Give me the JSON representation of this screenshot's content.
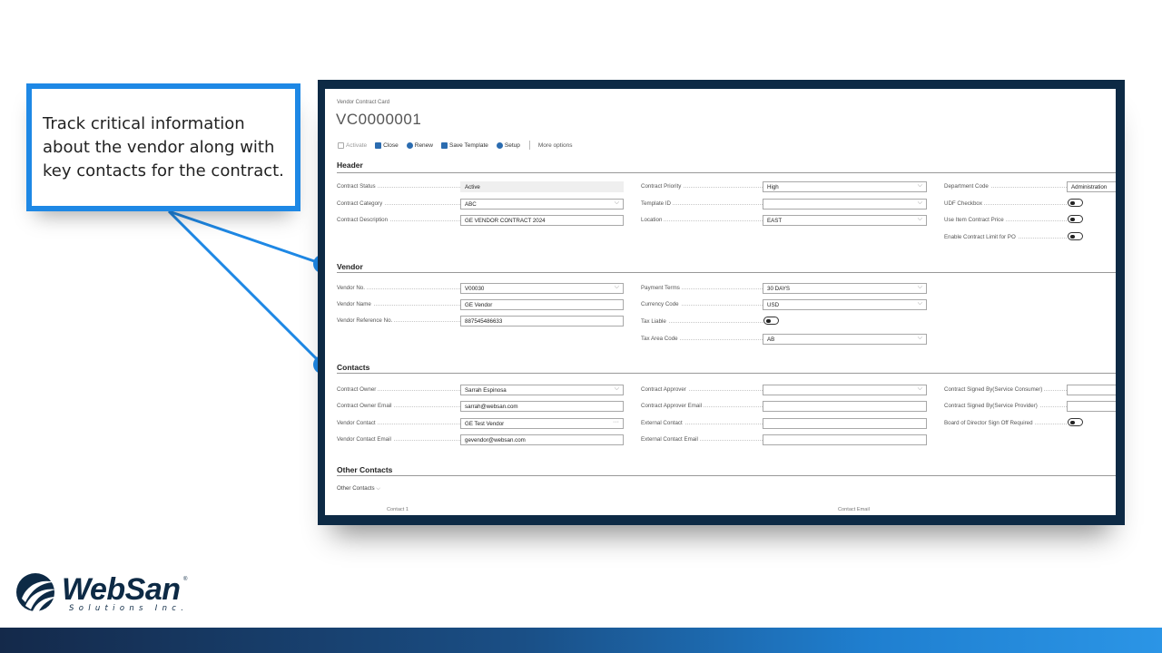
{
  "callout": {
    "text": "Track critical information about the vendor along with key contacts for the contract."
  },
  "page": {
    "breadcrumb": "Vendor Contract Card",
    "title": "VC0000001"
  },
  "toolbar": {
    "activate": "Activate",
    "close": "Close",
    "renew": "Renew",
    "save_template": "Save Template",
    "setup": "Setup",
    "more_options": "More options"
  },
  "sections": {
    "header": "Header",
    "vendor": "Vendor",
    "contacts": "Contacts",
    "other_contacts": "Other Contacts"
  },
  "header": {
    "contract_status": {
      "label": "Contract Status",
      "value": "Active"
    },
    "contract_category": {
      "label": "Contract Category",
      "value": "ABC"
    },
    "contract_description": {
      "label": "Contract Description",
      "value": "GE VENDOR CONTRACT 2024"
    },
    "contract_priority": {
      "label": "Contract Priority",
      "value": "High"
    },
    "template_id": {
      "label": "Template ID",
      "value": ""
    },
    "location": {
      "label": "Location",
      "value": "EAST"
    },
    "department_code": {
      "label": "Department Code",
      "value": "Administration"
    },
    "udf_checkbox": {
      "label": "UDF Checkbox"
    },
    "use_item_contract_price": {
      "label": "Use Item Contract Price"
    },
    "enable_contract_limit": {
      "label": "Enable Contract Limit for PO"
    }
  },
  "vendor": {
    "vendor_no": {
      "label": "Vendor No.",
      "value": "V00030"
    },
    "vendor_name": {
      "label": "Vendor Name",
      "value": "GE Vendor"
    },
    "vendor_reference_no": {
      "label": "Vendor Reference No.",
      "value": "887545486633"
    },
    "payment_terms": {
      "label": "Payment Terms",
      "value": "30 DAYS"
    },
    "currency_code": {
      "label": "Currency Code",
      "value": "USD"
    },
    "tax_liable": {
      "label": "Tax Liable"
    },
    "tax_area_code": {
      "label": "Tax Area Code",
      "value": "AB"
    }
  },
  "contacts": {
    "contract_owner": {
      "label": "Contract Owner",
      "value": "Sarrah Espinosa"
    },
    "contract_owner_email": {
      "label": "Contract Owner Email",
      "value": "sarrah@websan.com"
    },
    "vendor_contact": {
      "label": "Vendor Contact",
      "value": "GE Test Vendor"
    },
    "vendor_contact_email": {
      "label": "Vendor Contact Email",
      "value": "gevendor@websan.com"
    },
    "contract_approver": {
      "label": "Contract Approver",
      "value": ""
    },
    "contract_approver_email": {
      "label": "Contract Approver Email",
      "value": ""
    },
    "external_contact": {
      "label": "External Contact",
      "value": ""
    },
    "external_contact_email": {
      "label": "External Contact Email",
      "value": ""
    },
    "signed_by_consumer": {
      "label": "Contract Signed By(Service Consumer)",
      "value": ""
    },
    "signed_by_provider": {
      "label": "Contract Signed By(Service Provider)",
      "value": ""
    },
    "board_sign_off": {
      "label": "Board of Director Sign Off Required"
    }
  },
  "other_contacts": {
    "toggle_label": "Other Contacts",
    "col_contact": "Contact 1",
    "col_email": "Contact Email"
  },
  "logo": {
    "name": "WebSan",
    "registered": "®",
    "sub": "Solutions Inc."
  },
  "colors": {
    "accent": "#1e88e5",
    "frame": "#0d2a45",
    "brand": "#0d2a45"
  }
}
